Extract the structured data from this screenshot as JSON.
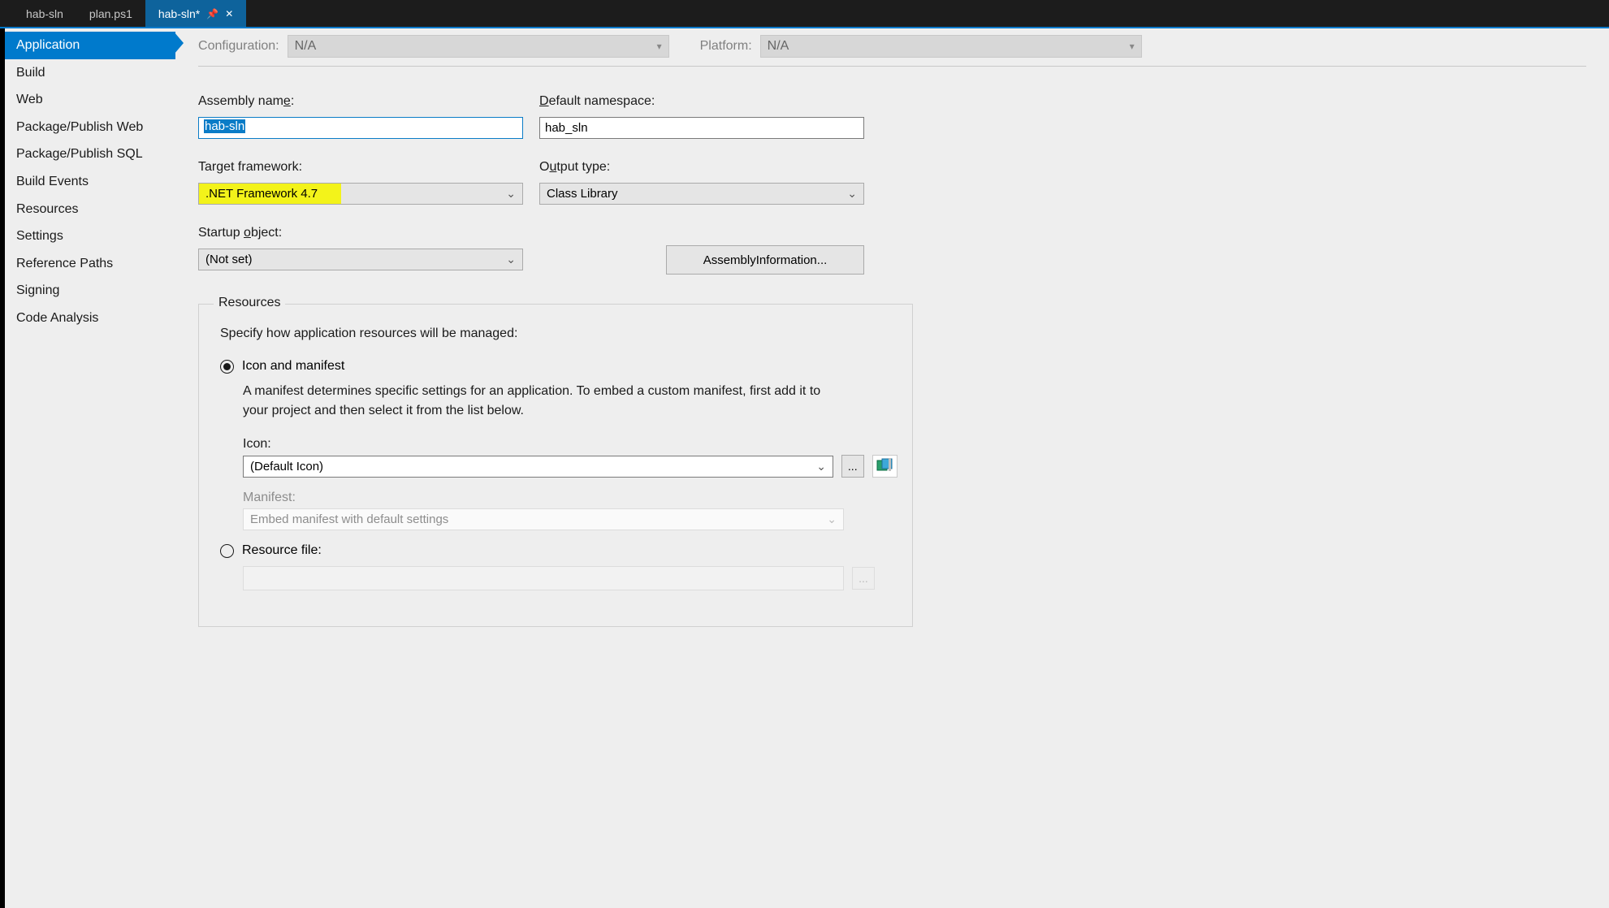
{
  "tabs": [
    {
      "label": "hab-sln"
    },
    {
      "label": "plan.ps1"
    },
    {
      "label": "hab-sln*"
    }
  ],
  "sideTabs": [
    "Application",
    "Build",
    "Web",
    "Package/Publish Web",
    "Package/Publish SQL",
    "Build Events",
    "Resources",
    "Settings",
    "Reference Paths",
    "Signing",
    "Code Analysis"
  ],
  "toprow": {
    "configLabel": "Configuration:",
    "configValue": "N/A",
    "platformLabel": "Platform:",
    "platformValue": "N/A"
  },
  "fields": {
    "assemblyNameLabel": "Assembly name:",
    "assemblyNameValue": "hab-sln",
    "defaultNamespaceLabel": "Default namespace:",
    "defaultNamespaceValue": "hab_sln",
    "targetFrameworkLabel": "Target framework:",
    "targetFrameworkValue": ".NET Framework 4.7",
    "outputTypeLabel": "Output type:",
    "outputTypeValue": "Class Library",
    "startupObjectLabel": "Startup object:",
    "startupObjectValue": "(Not set)",
    "assemblyInfoButton": "Assembly Information..."
  },
  "resources": {
    "legend": "Resources",
    "desc": "Specify how application resources will be managed:",
    "radioIconManifest": "Icon and manifest",
    "manifestDesc": "A manifest determines specific settings for an application. To embed a custom manifest, first add it to your project and then select it from the list below.",
    "iconLabel": "Icon:",
    "iconValue": "(Default Icon)",
    "manifestLabel": "Manifest:",
    "manifestValue": "Embed manifest with default settings",
    "radioResourceFile": "Resource file:",
    "browse": "..."
  }
}
